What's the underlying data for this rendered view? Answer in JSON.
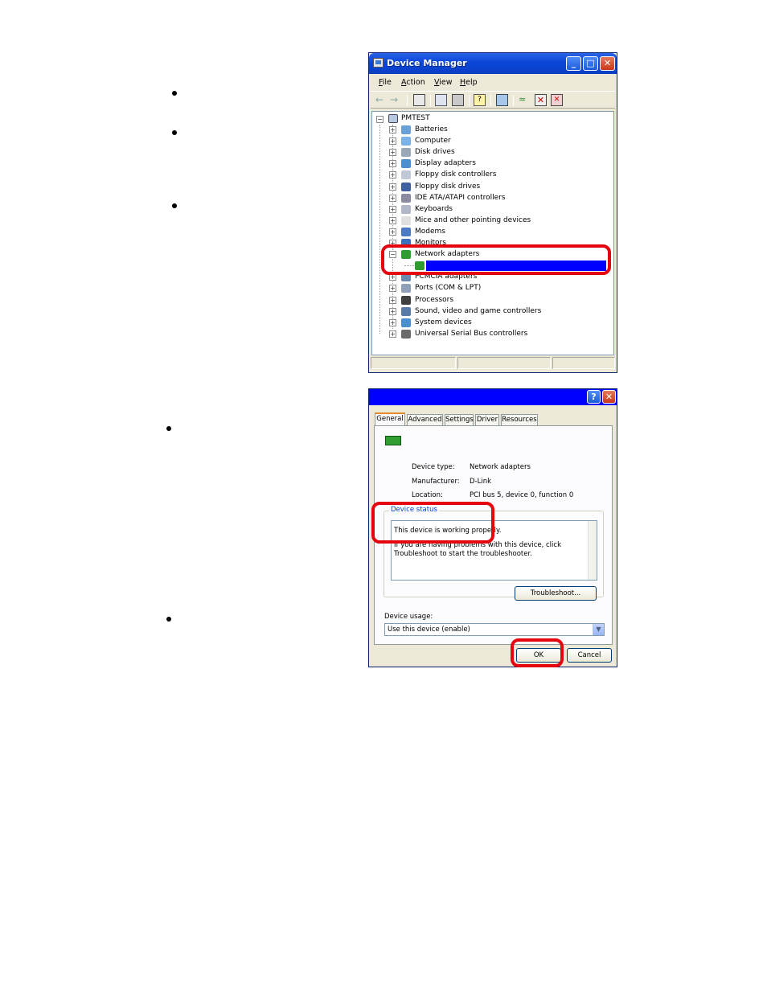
{
  "colors": {
    "highlight": "#e4050f",
    "selection": "#0000ff",
    "title_blue": "#0a46d8"
  },
  "device_manager": {
    "title": "Device Manager",
    "menu": [
      {
        "underline": "F",
        "rest": "ile"
      },
      {
        "underline": "A",
        "rest": "ction"
      },
      {
        "underline": "V",
        "rest": "iew"
      },
      {
        "underline": "H",
        "rest": "elp"
      }
    ],
    "toolbar_icons": [
      "back-arrow-icon",
      "forward-arrow-icon",
      "show-hide-tree-icon",
      "properties-icon",
      "print-icon",
      "help-icon",
      "scan-hardware-icon",
      "update-driver-icon",
      "disable-device-icon",
      "uninstall-device-icon"
    ],
    "root": "PMTEST",
    "categories": [
      "Batteries",
      "Computer",
      "Disk drives",
      "Display adapters",
      "Floppy disk controllers",
      "Floppy disk drives",
      "IDE ATA/ATAPI controllers",
      "Keyboards",
      "Mice and other pointing devices",
      "Modems",
      "Monitors",
      "Network adapters",
      "",
      "PCMCIA adapters",
      "Ports (COM & LPT)",
      "Processors",
      "Sound, video and game controllers",
      "System devices",
      "Universal Serial Bus controllers"
    ]
  },
  "properties": {
    "title": "",
    "tabs": [
      "General",
      "Advanced",
      "Settings",
      "Driver",
      "Resources"
    ],
    "fields": [
      {
        "label": "Device type:",
        "value": "Network adapters"
      },
      {
        "label": "Manufacturer:",
        "value": "D-Link"
      },
      {
        "label": "Location:",
        "value": "PCI bus 5, device 0, function 0"
      }
    ],
    "device_status_title": "Device status",
    "status_line1": "This device is working properly.",
    "status_line2": "If you are having problems with this device, click Troubleshoot to start the troubleshooter.",
    "troubleshoot_label": "Troubleshoot...",
    "device_usage_label": "Device usage:",
    "device_usage_value": "Use this device (enable)",
    "ok_label": "OK",
    "cancel_label": "Cancel"
  }
}
